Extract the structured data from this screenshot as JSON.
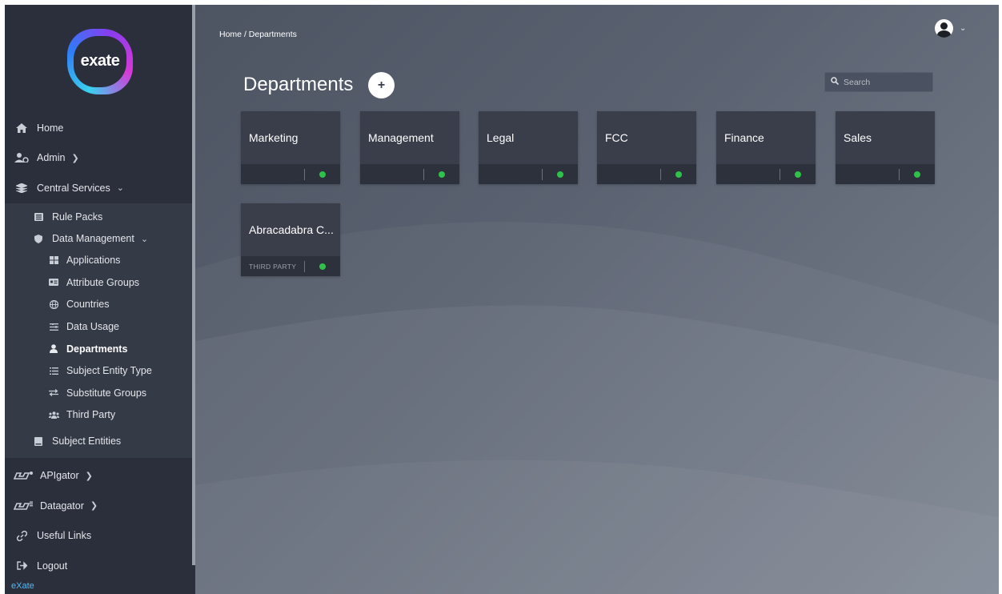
{
  "logo": {
    "text": "exate"
  },
  "sidebar": {
    "items": [
      {
        "label": "Home",
        "icon": "home-icon"
      },
      {
        "label": "Admin",
        "icon": "admin-icon"
      },
      {
        "label": "Central Services",
        "icon": "layers-icon"
      }
    ],
    "central_sub": [
      {
        "label": "Rule Packs",
        "icon": "rulepacks-icon"
      },
      {
        "label": "Data Management",
        "icon": "shield-icon"
      }
    ],
    "data_management_sub": [
      {
        "label": "Applications",
        "icon": "grid-icon"
      },
      {
        "label": "Attribute Groups",
        "icon": "id-card-icon"
      },
      {
        "label": "Countries",
        "icon": "globe-icon"
      },
      {
        "label": "Data Usage",
        "icon": "sliders-icon"
      },
      {
        "label": "Departments",
        "icon": "user-icon"
      },
      {
        "label": "Subject Entity Type",
        "icon": "list-icon"
      },
      {
        "label": "Substitute Groups",
        "icon": "exchange-icon"
      },
      {
        "label": "Third Party",
        "icon": "users-icon"
      }
    ],
    "subject_entities": {
      "label": "Subject Entities",
      "icon": "book-icon"
    },
    "bottom_items": [
      {
        "label": "APIgator",
        "icon": "gator-icon"
      },
      {
        "label": "Datagator",
        "icon": "gator-icon"
      },
      {
        "label": "Useful Links",
        "icon": "link-icon"
      },
      {
        "label": "Logout",
        "icon": "logout-icon"
      }
    ],
    "footer": "eXate"
  },
  "breadcrumb": {
    "home": "Home",
    "sep": "/",
    "current": "Departments"
  },
  "page": {
    "title": "Departments",
    "add_label": "+"
  },
  "search": {
    "placeholder": "Search"
  },
  "departments": [
    {
      "name": "Marketing",
      "tag": "",
      "status": "active"
    },
    {
      "name": "Management",
      "tag": "",
      "status": "active"
    },
    {
      "name": "Legal",
      "tag": "",
      "status": "active"
    },
    {
      "name": "FCC",
      "tag": "",
      "status": "active"
    },
    {
      "name": "Finance",
      "tag": "",
      "status": "active"
    },
    {
      "name": "Sales",
      "tag": "",
      "status": "active"
    },
    {
      "name": "Abracadabra C...",
      "tag": "THIRD PARTY",
      "status": "active"
    }
  ],
  "colors": {
    "sidebar_bg": "#2b2f3c",
    "card_bg": "#3a3e4b",
    "status_green": "#2ec24a",
    "link_blue": "#55b8f2"
  }
}
